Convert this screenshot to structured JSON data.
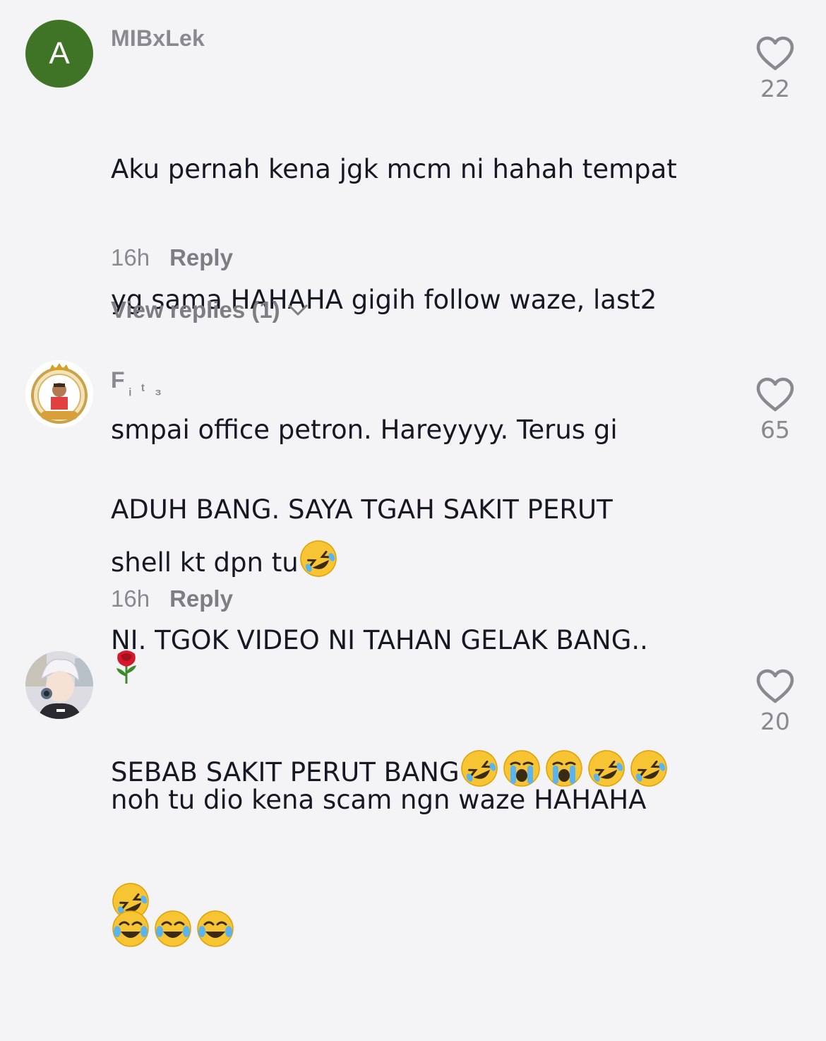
{
  "comments": [
    {
      "username": "MIBxLek",
      "avatar_letter": "A",
      "avatar_color": "#3f7426",
      "text_lines": [
        "Aku pernah kena jgk mcm ni hahah tempat",
        "yg sama HAHAHA gigih follow waze, last2",
        "smpai office petron. Hareyyyy. Terus gi",
        "shell kt dpn tu"
      ],
      "trailing_emojis": [
        "rolling-laughing"
      ],
      "time": "16h",
      "reply_label": "Reply",
      "view_replies": "View replies (1)",
      "likes": "22"
    },
    {
      "username_main": "F",
      "username_sub": "ᵢ ᵗ ₃",
      "avatar_desc": "crowned-badge-avatar",
      "text_lines": [
        "ADUH BANG. SAYA TGAH SAKIT PERUT",
        "NI. TGOK VIDEO NI TAHAN GELAK BANG..",
        "SEBAB SAKIT PERUT BANG"
      ],
      "trailing_emojis": [
        "rolling-laughing",
        "loudly-crying",
        "loudly-crying",
        "rolling-laughing",
        "rolling-laughing",
        "rolling-laughing"
      ],
      "time": "16h",
      "reply_label": "Reply",
      "likes": "65"
    },
    {
      "username_emoji": "rose",
      "avatar_desc": "anime-character-avatar",
      "text_lines": [
        "noh tu dio kena scam ngn waze HAHAHA"
      ],
      "trailing_emojis": [
        "tears-of-joy",
        "tears-of-joy",
        "tears-of-joy"
      ],
      "likes": "20"
    }
  ],
  "colors": {
    "background": "#f4f4f6",
    "secondary_text": "#8a8a8e",
    "primary_text": "#161823"
  }
}
